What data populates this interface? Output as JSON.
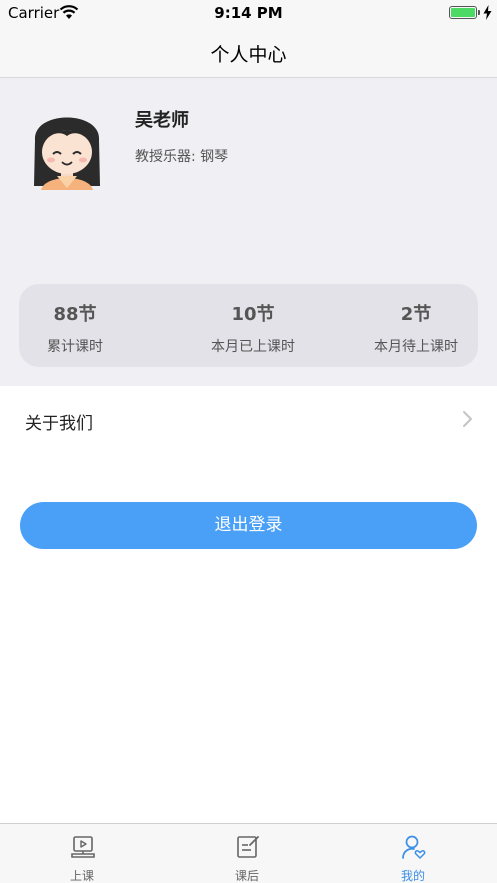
{
  "status_bar": {
    "carrier": "Carrier",
    "time": "9:14 PM",
    "battery_color": "#4cd964"
  },
  "nav": {
    "title": "个人中心"
  },
  "profile": {
    "name": "吴老师",
    "instrument": "教授乐器: 钢琴"
  },
  "stats": [
    {
      "value": "88节",
      "label": "累计课时"
    },
    {
      "value": "10节",
      "label": "本月已上课时"
    },
    {
      "value": "2节",
      "label": "本月待上课时"
    }
  ],
  "about": {
    "label": "关于我们",
    "icon": "chevron-right-icon"
  },
  "logout": {
    "label": "退出登录",
    "color": "#4aa0f7"
  },
  "tabs": [
    {
      "label": "上课",
      "icon": "class-video-icon",
      "active": false
    },
    {
      "label": "课后",
      "icon": "edit-note-icon",
      "active": false
    },
    {
      "label": "我的",
      "icon": "user-icon",
      "active": true
    }
  ],
  "colors": {
    "accent": "#4aa0f7",
    "tab_active": "#3b8fe6",
    "profile_bg": "#efeff4"
  }
}
